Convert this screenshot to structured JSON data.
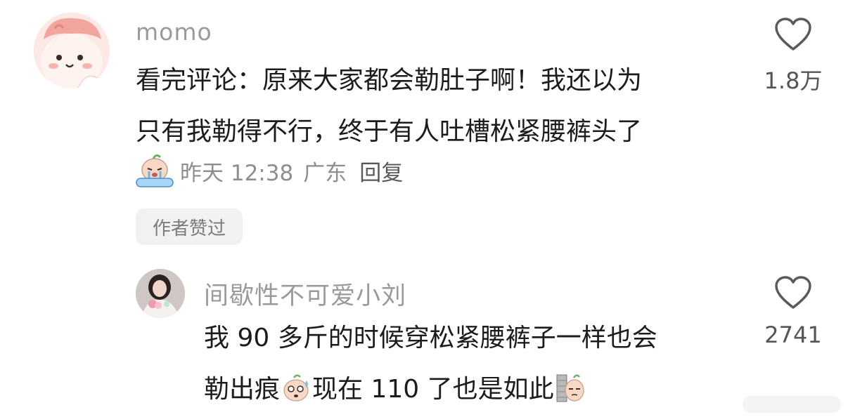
{
  "comment": {
    "username": "momo",
    "text_line1": "看完评论：原来大家都会勒肚子啊！我还以为",
    "text_line2": "只有我勒得不行，终于有人吐槽松紧腰裤头了",
    "time": "昨天 12:38",
    "location": "广东",
    "reply_label": "回复",
    "author_badge": "作者赞过",
    "likes": "1.8万"
  },
  "reply": {
    "username": "间歇性不可爱小刘",
    "text_line1": "我 90 多斤的时候穿松紧腰裤子一样也会",
    "text_line2_part1": "勒出痕",
    "text_line2_part2": "现在 110 了也是如此",
    "likes": "2741"
  },
  "icons": {
    "like": "heart-outline-icon",
    "emoji_crying": "crying-sticker-icon",
    "emoji_sweat": "sweat-sticker-icon",
    "emoji_peek": "peeking-sticker-icon"
  },
  "colors": {
    "username": "#9a9a9a",
    "body_text": "#1c1c1c",
    "meta": "#8e8e8e",
    "badge_bg": "#f1f1f1"
  }
}
